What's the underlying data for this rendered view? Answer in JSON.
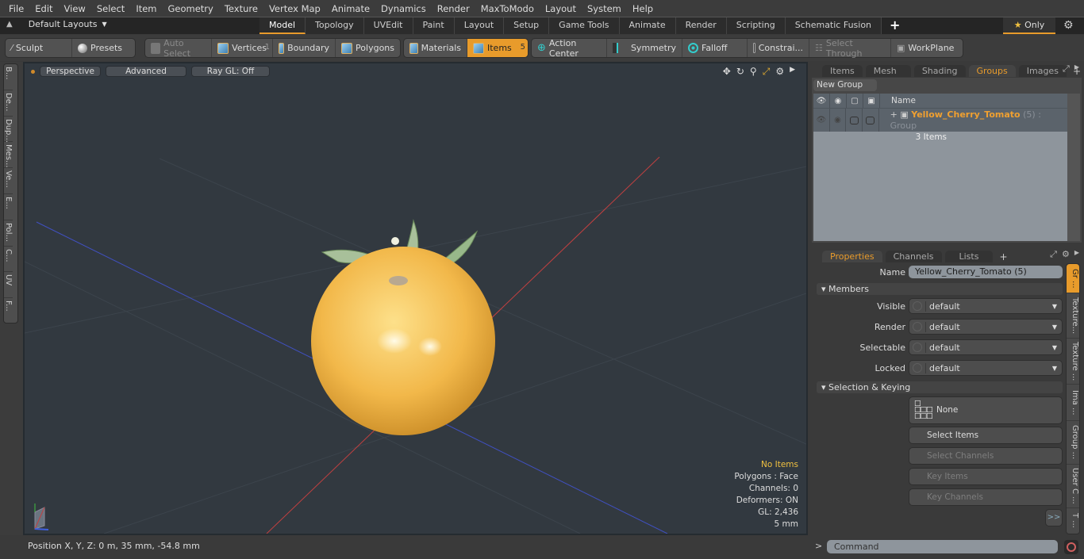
{
  "menu": [
    "File",
    "Edit",
    "View",
    "Select",
    "Item",
    "Geometry",
    "Texture",
    "Vertex Map",
    "Animate",
    "Dynamics",
    "Render",
    "MaxToModo",
    "Layout",
    "System",
    "Help"
  ],
  "layoutbar": {
    "layout_label": "Default Layouts",
    "tabs": [
      "Model",
      "Topology",
      "UVEdit",
      "Paint",
      "Layout",
      "Setup",
      "Game Tools",
      "Animate",
      "Render",
      "Scripting",
      "Schematic Fusion"
    ],
    "active_tab": "Model",
    "only_label": "Only"
  },
  "toolbar": {
    "sculpt": "Sculpt",
    "presets": "Presets",
    "auto_select": "Auto Select",
    "vertices": "Vertices",
    "vertices_count": "1",
    "boundary": "Boundary",
    "polygons": "Polygons",
    "materials": "Materials",
    "items": "Items",
    "items_count": "5",
    "action_center": "Action Center",
    "symmetry": "Symmetry",
    "falloff": "Falloff",
    "constraints": "Constrai...",
    "select_through": "Select Through",
    "workplane": "WorkPlane"
  },
  "left_tabs": [
    "B...",
    "De...",
    "Dup...",
    "Mes...",
    "Ve...",
    "E...",
    "Pol...",
    "C...",
    "UV",
    "F..."
  ],
  "viewport": {
    "view_mode": "Perspective",
    "shading": "Advanced",
    "raygl": "Ray GL: Off",
    "info": {
      "selection": "No Items",
      "polygons": "Polygons : Face",
      "channels": "Channels: 0",
      "deformers": "Deformers: ON",
      "gl": "GL: 2,436",
      "grid": "5 mm"
    },
    "colors": {
      "bg": "#323940",
      "tomato": "#f2b84a",
      "x_axis": "#c04040",
      "z_axis": "#4050c0"
    }
  },
  "status": {
    "position": "Position X, Y, Z:   0 m, 35 mm, -54.8 mm"
  },
  "groups_panel": {
    "tabs": [
      "Items",
      "Mesh ...",
      "Shading",
      "Groups",
      "Images"
    ],
    "active_tab": "Groups",
    "new_group": "New Group",
    "column_name": "Name",
    "rows": [
      {
        "name": "Yellow_Cherry_Tomato",
        "suffix": "(5) : Group",
        "sub": "3 Items"
      }
    ]
  },
  "properties_panel": {
    "tabs": [
      "Properties",
      "Channels",
      "Lists"
    ],
    "active_tab": "Properties",
    "name_label": "Name",
    "name_value": "Yellow_Cherry_Tomato (5)",
    "members_section": "Members",
    "fields": [
      {
        "label": "Visible",
        "value": "default"
      },
      {
        "label": "Render",
        "value": "default"
      },
      {
        "label": "Selectable",
        "value": "default"
      },
      {
        "label": "Locked",
        "value": "default"
      }
    ],
    "keying_section": "Selection & Keying",
    "none_label": "None",
    "select_items": "Select Items",
    "select_channels": "Select Channels",
    "key_items": "Key Items",
    "key_channels": "Key Channels",
    "more": ">>",
    "side_tabs": [
      "Gr ...",
      "Texture...",
      "Texture ...",
      "Ima ...",
      "Group ...",
      "User C ...",
      "T ..."
    ]
  },
  "command": {
    "prompt": ">",
    "placeholder": "Command"
  },
  "accent": "#e89b2b"
}
